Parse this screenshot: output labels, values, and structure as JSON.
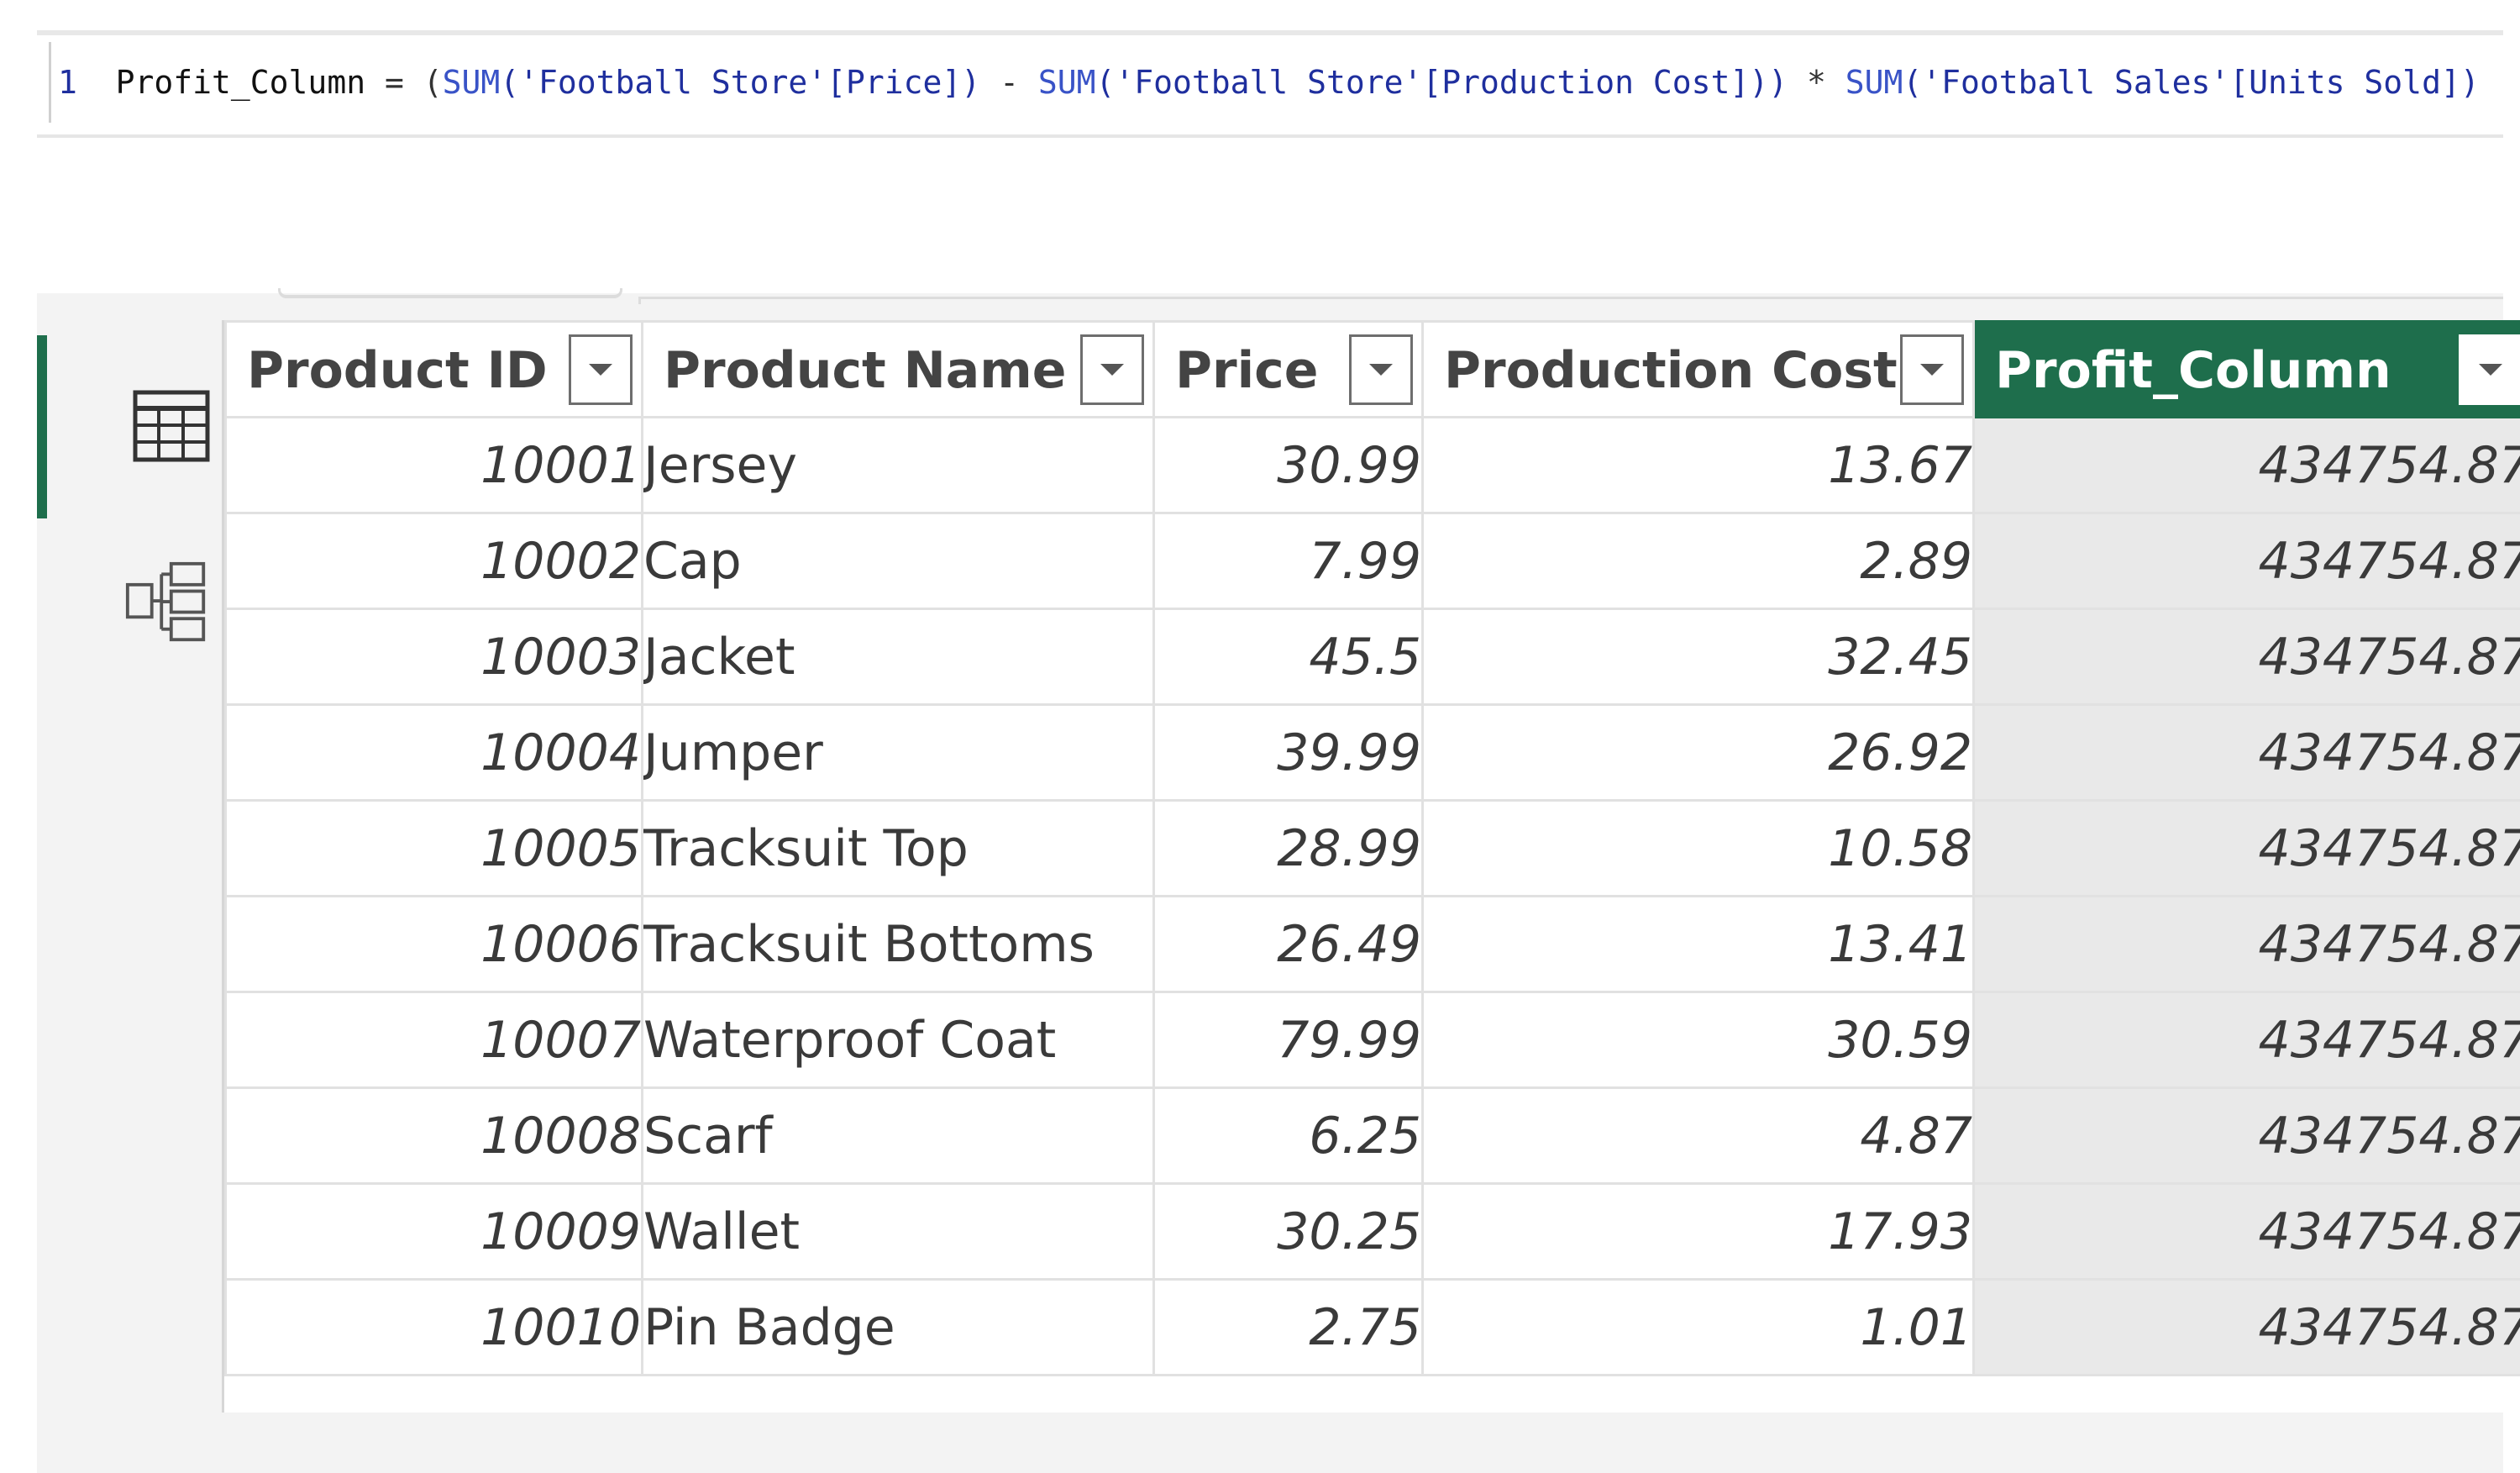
{
  "formula": {
    "line_number": "1",
    "column_name": "Profit_Column",
    "equals": " = (",
    "fn1": "SUM",
    "arg1": "('Football Store'[Price])",
    "minus": " - ",
    "fn2": "SUM",
    "arg2": "('Football Store'[Production Cost]))",
    "times": " * ",
    "fn3": "SUM",
    "arg3": "('Football Sales'[Units Sold])"
  },
  "sidebar": {
    "table_view_icon": "table-icon",
    "model_view_icon": "model-icon",
    "accent_color": "#1e6e4c"
  },
  "table": {
    "headers": [
      "Product ID",
      "Product Name",
      "Price",
      "Production Cost",
      "Profit_Column"
    ],
    "rows": [
      [
        "10001",
        "Jersey",
        "30.99",
        "13.67",
        "434754.87"
      ],
      [
        "10002",
        "Cap",
        "7.99",
        "2.89",
        "434754.87"
      ],
      [
        "10003",
        "Jacket",
        "45.5",
        "32.45",
        "434754.87"
      ],
      [
        "10004",
        "Jumper",
        "39.99",
        "26.92",
        "434754.87"
      ],
      [
        "10005",
        "Tracksuit Top",
        "28.99",
        "10.58",
        "434754.87"
      ],
      [
        "10006",
        "Tracksuit Bottoms",
        "26.49",
        "13.41",
        "434754.87"
      ],
      [
        "10007",
        "Waterproof Coat",
        "79.99",
        "30.59",
        "434754.87"
      ],
      [
        "10008",
        "Scarf",
        "6.25",
        "4.87",
        "434754.87"
      ],
      [
        "10009",
        "Wallet",
        "30.25",
        "17.93",
        "434754.87"
      ],
      [
        "10010",
        "Pin Badge",
        "2.75",
        "1.01",
        "434754.87"
      ]
    ],
    "selected_column_color": "#1e6e4c"
  }
}
